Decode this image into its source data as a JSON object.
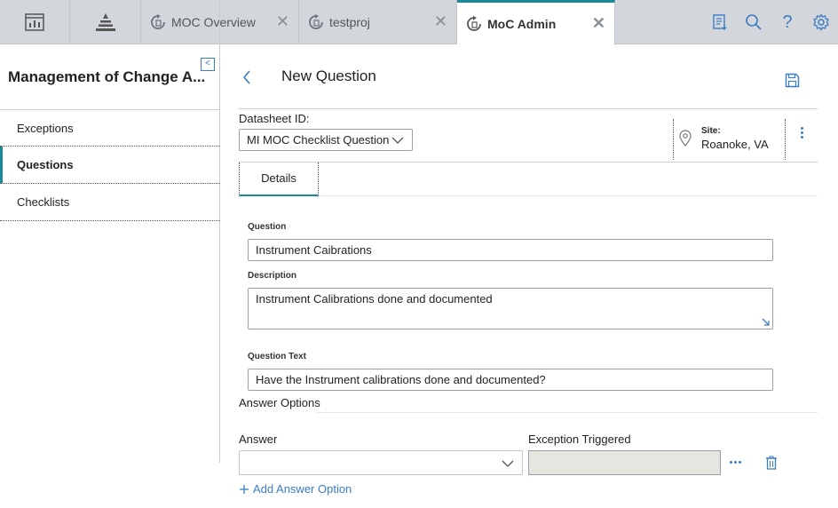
{
  "topbar": {
    "tabs": [
      {
        "label": "MOC Overview",
        "icon": "refresh-doc-icon"
      },
      {
        "label": "testproj",
        "icon": "refresh-doc-icon"
      },
      {
        "label": "MoC Admin",
        "icon": "refresh-doc-icon",
        "active": true
      }
    ],
    "close_glyph": "✕",
    "left_icons": [
      "dashboard-icon",
      "pyramid-icon"
    ],
    "right_icons": [
      "report-add-icon",
      "search-icon",
      "help-icon",
      "settings-icon"
    ],
    "help_glyph": "?"
  },
  "sidebar": {
    "title": "Management of Change A...",
    "items": [
      {
        "label": "Exceptions"
      },
      {
        "label": "Questions",
        "active": true
      },
      {
        "label": "Checklists"
      }
    ]
  },
  "main": {
    "title": "New Question",
    "datasheet_label": "Datasheet ID:",
    "datasheet_value": "MI MOC Checklist Question",
    "site_label": "Site:",
    "site_value": "Roanoke, VA",
    "tabs": [
      {
        "label": "Details"
      }
    ],
    "fields": {
      "question_label": "Question",
      "question_value": "Instrument Caibrations",
      "description_label": "Description",
      "description_value": "Instrument Calibrations done and documented",
      "question_text_label": "Question Text",
      "question_text_value": "Have the Instrument calibrations done and documented?"
    },
    "answer_options": {
      "section_label": "Answer Options",
      "answer_col": "Answer",
      "exception_col": "Exception Triggered",
      "answer_value": "",
      "add_label": "Add Answer Option"
    }
  },
  "colors": {
    "accent": "#1a8a96",
    "link": "#3b7cc4",
    "topbar_bg": "#d3d7dc"
  }
}
